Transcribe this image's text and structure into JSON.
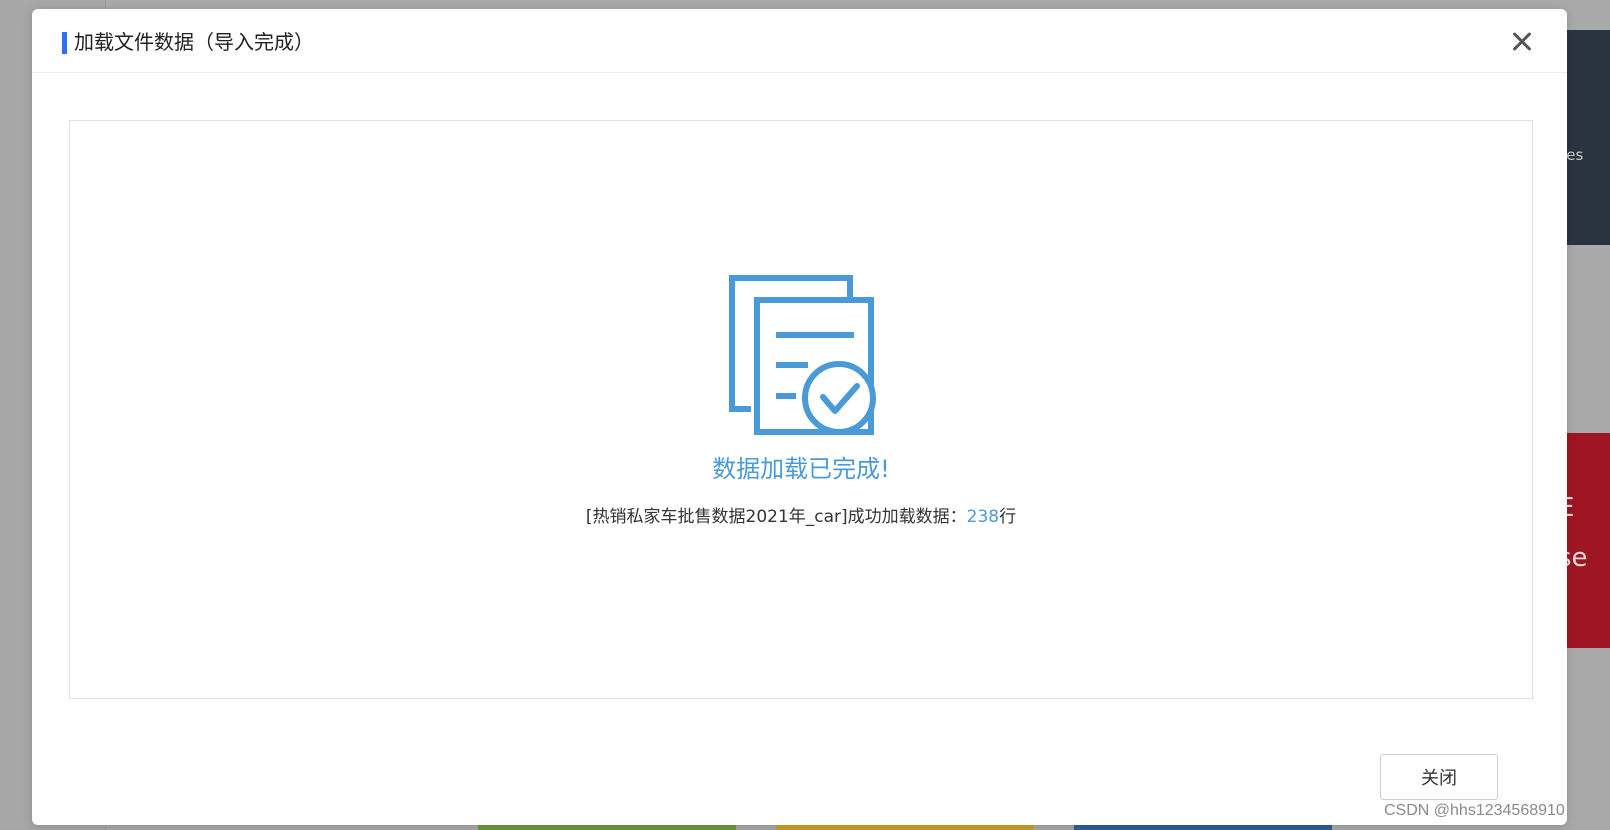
{
  "background": {
    "right_panel_text": "ces",
    "right_brand_text_1": "E",
    "right_brand_text_2": "se"
  },
  "dialog": {
    "title": "加载文件数据（导入完成）",
    "close_icon": "close-icon",
    "accent_color": "#2f6ff2",
    "result": {
      "icon": "document-check-icon",
      "icon_color": "#4a9ad8",
      "headline": "数据加载已完成!",
      "detail_prefix": "[热销私家车批售数据2021年_car]成功加载数据：",
      "row_count": "238",
      "detail_suffix": "行"
    },
    "close_button_label": "关闭"
  },
  "watermark": "CSDN @hhs1234568910"
}
